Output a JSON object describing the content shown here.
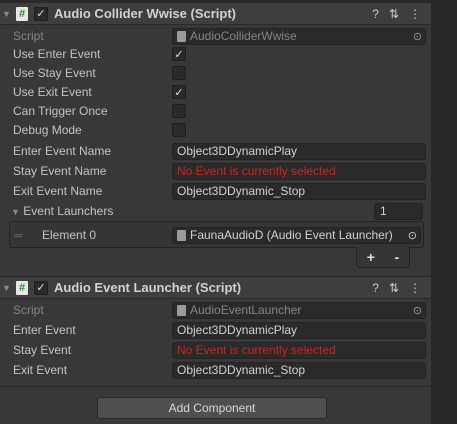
{
  "component1": {
    "title": "Audio Collider Wwise (Script)",
    "enabled": true,
    "script_label": "Script",
    "script_value": "AudioColliderWwise",
    "use_enter_label": "Use Enter Event",
    "use_enter": true,
    "use_stay_label": "Use Stay Event",
    "use_stay": false,
    "use_exit_label": "Use Exit Event",
    "use_exit": true,
    "can_trigger_label": "Can Trigger Once",
    "can_trigger": false,
    "debug_label": "Debug Mode",
    "debug": false,
    "enter_name_label": "Enter Event Name",
    "enter_name": "Object3DDynamicPlay",
    "stay_name_label": "Stay Event Name",
    "stay_name": "No Event is currently selected",
    "exit_name_label": "Exit Event Name",
    "exit_name": "Object3DDynamic_Stop",
    "launchers_label": "Event Launchers",
    "launchers_count": "1",
    "element0_label": "Element 0",
    "element0_value": "FaunaAudioD (Audio Event Launcher)",
    "add": "+",
    "remove": "-"
  },
  "component2": {
    "title": "Audio Event Launcher (Script)",
    "enabled": true,
    "script_label": "Script",
    "script_value": "AudioEventLauncher",
    "enter_label": "Enter Event",
    "enter_value": "Object3DDynamicPlay",
    "stay_label": "Stay Event",
    "stay_value": "No Event is currently selected",
    "exit_label": "Exit Event",
    "exit_value": "Object3DDynamic_Stop"
  },
  "add_component": "Add Component",
  "icons": {
    "hash": "#",
    "check": "✓",
    "help": "?",
    "settings": "⇅",
    "more": "⋮",
    "target": "⊙",
    "fold": "▼"
  },
  "colors": {
    "error_text": "#d42020"
  }
}
